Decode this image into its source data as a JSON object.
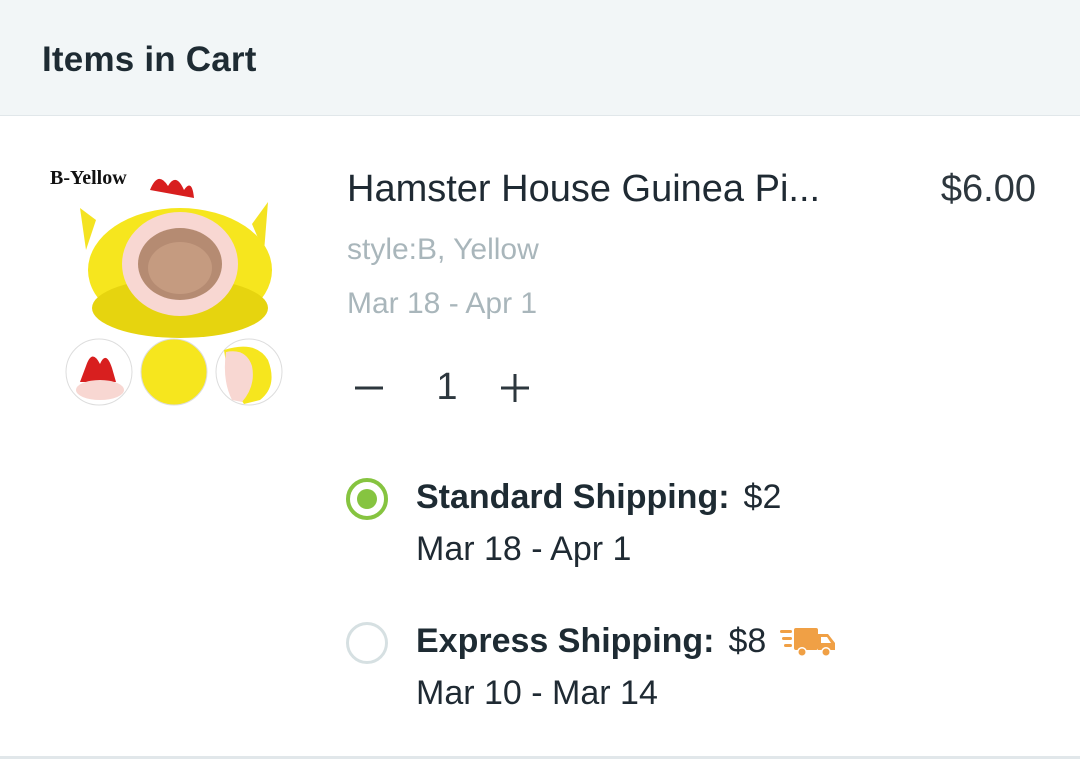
{
  "header": {
    "title": "Items in Cart"
  },
  "item": {
    "image": {
      "variant_label": "B-Yellow",
      "icon": "hamster-house-image"
    },
    "name": "Hamster House Guinea Pi...",
    "price": "$6.00",
    "style": "style:B, Yellow",
    "delivery_dates": "Mar 18 - Apr 1",
    "quantity": "1"
  },
  "shipping": {
    "standard": {
      "label": "Standard Shipping:",
      "price": "$2",
      "dates": "Mar 18 - Apr 1",
      "selected": true
    },
    "express": {
      "label": "Express Shipping:",
      "price": "$8",
      "dates": "Mar 10 - Mar 14",
      "selected": false,
      "icon": "fast-truck-icon"
    }
  },
  "colors": {
    "accent_green": "#86c440",
    "truck_orange": "#f0a045",
    "muted_text": "#a9b6bb"
  }
}
